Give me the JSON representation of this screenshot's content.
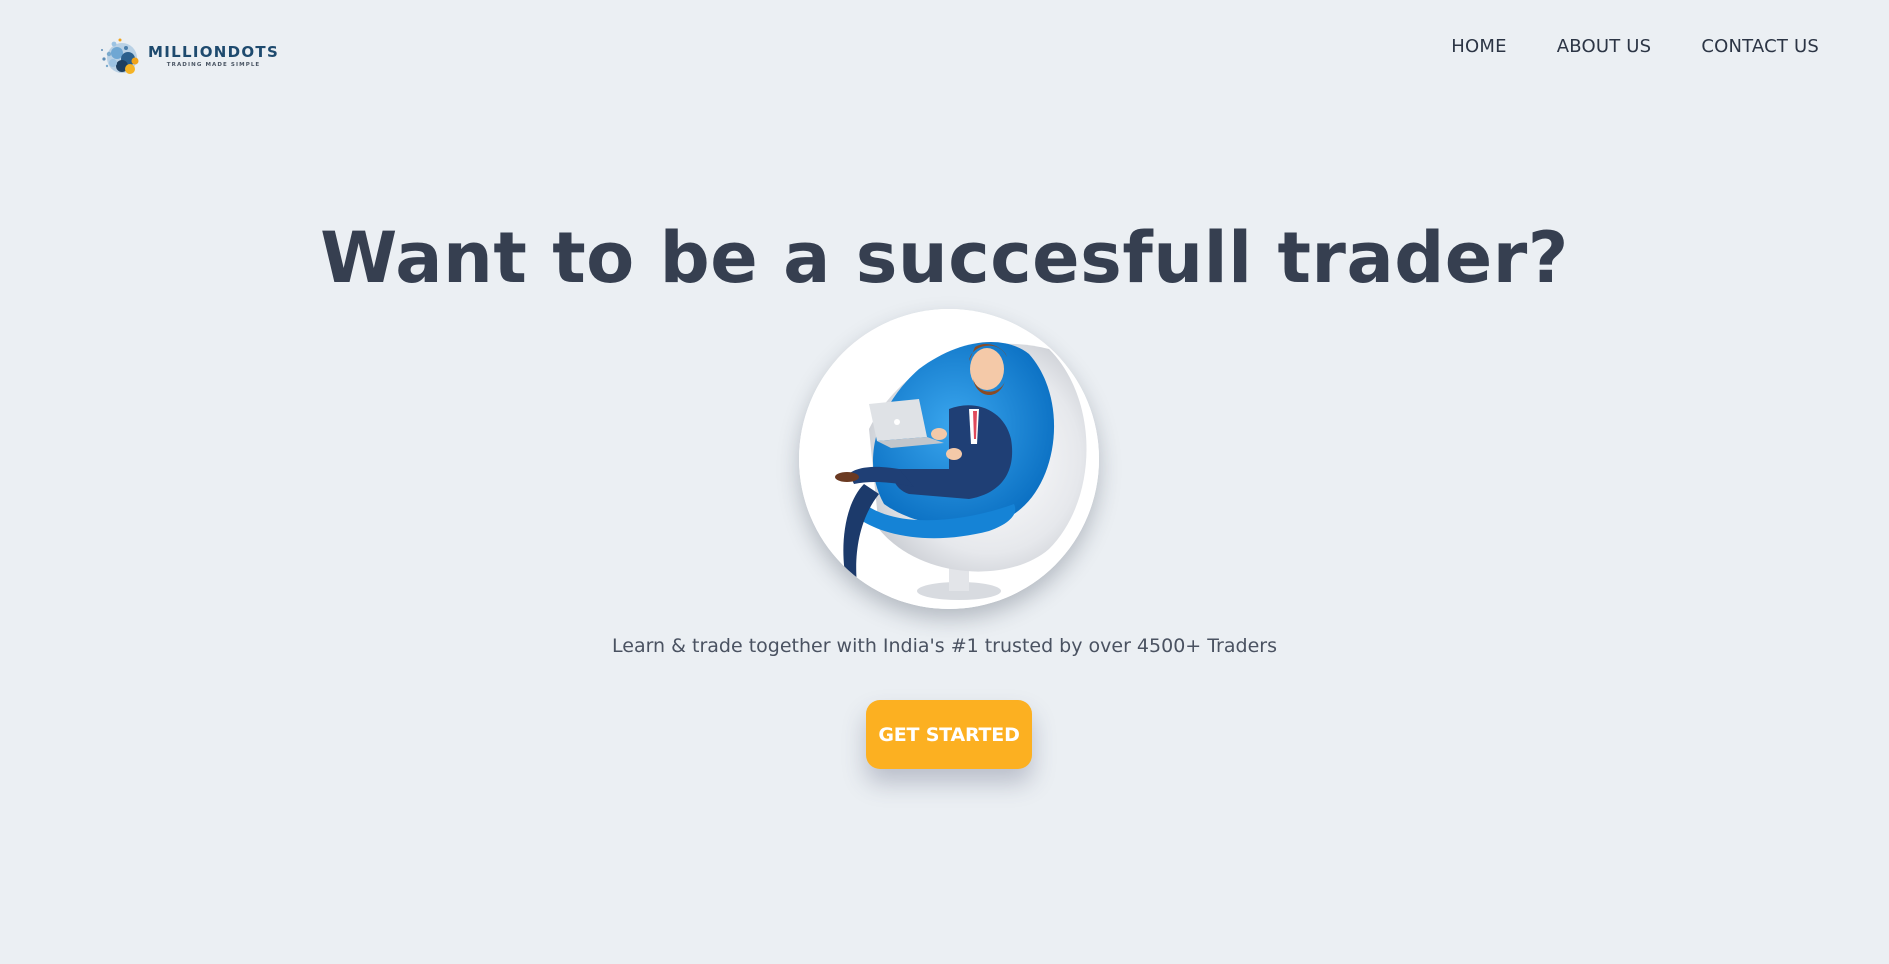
{
  "brand": {
    "name": "MILLIONDOTS",
    "tagline": "TRADING MADE SIMPLE",
    "logo_icon": "dots-globe-icon",
    "colors": {
      "primary_text": "#1e4a6e",
      "accent": "#fcb021",
      "background": "#ebeff3",
      "heading": "#363f50"
    }
  },
  "nav": {
    "items": [
      {
        "label": "HOME"
      },
      {
        "label": "ABOUT US"
      },
      {
        "label": "CONTACT US"
      }
    ]
  },
  "hero": {
    "title": "Want to be a succesfull trader?",
    "image": "trader-in-egg-chair-illustration",
    "subtitle": "Learn & trade together with India's #1 trusted by over 4500+ Traders",
    "cta_label": "GET STARTED"
  }
}
